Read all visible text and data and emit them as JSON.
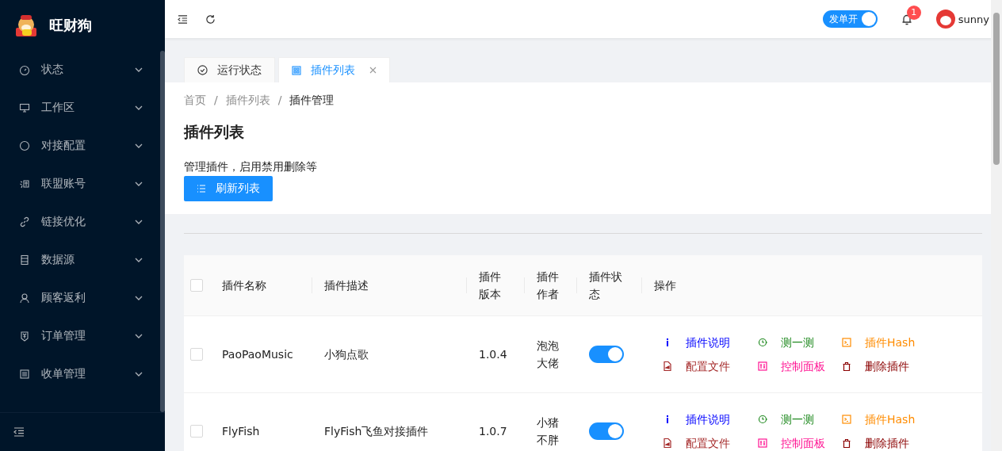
{
  "sidebar": {
    "brand": "旺财狗",
    "items": [
      {
        "label": "状态",
        "expanded": false
      },
      {
        "label": "工作区",
        "expanded": false
      },
      {
        "label": "对接配置",
        "expanded": false
      },
      {
        "label": "联盟账号",
        "expanded": false
      },
      {
        "label": "链接优化",
        "expanded": false
      },
      {
        "label": "数据源",
        "expanded": false
      },
      {
        "label": "顾客返利",
        "expanded": false
      },
      {
        "label": "订单管理",
        "expanded": false
      },
      {
        "label": "收单管理",
        "expanded": false
      }
    ]
  },
  "header": {
    "dispatch_switch": {
      "label": "发单开",
      "on": true
    },
    "notifications": "1",
    "user": "sunny"
  },
  "tabs": [
    {
      "label": "运行状态",
      "selected": false,
      "closable": false
    },
    {
      "label": "插件列表",
      "selected": true,
      "closable": true
    }
  ],
  "breadcrumb": [
    {
      "label": "首页",
      "kind": "link"
    },
    {
      "label": "/",
      "kind": "separator"
    },
    {
      "label": "插件列表",
      "kind": "link"
    },
    {
      "label": "/",
      "kind": "separator"
    },
    {
      "label": "插件管理",
      "kind": "current"
    }
  ],
  "page": {
    "title": "插件列表",
    "description": "管理插件，启用禁用删除等",
    "refresh_button": "刷新列表"
  },
  "table": {
    "all_checked": false,
    "columns": [
      "插件名称",
      "插件描述",
      "插件版本",
      "插件作者",
      "插件状态",
      "操作"
    ],
    "rows": [
      {
        "checked": false,
        "name": "PaoPaoMusic",
        "description": "小狗点歌",
        "version": "1.0.4",
        "author": "泡泡大佬",
        "on": true,
        "actions": [
          {
            "label": "插件说明",
            "kind": "info",
            "color": "#0000ff"
          },
          {
            "label": "测一测",
            "kind": "test",
            "color": "#228b22"
          },
          {
            "label": "插件Hash",
            "kind": "hash",
            "color": "#ff8c00"
          },
          {
            "label": "配置文件",
            "kind": "file",
            "color": "#a52a2a"
          },
          {
            "label": "控制面板",
            "kind": "panel",
            "color": "#ff1493"
          },
          {
            "label": "删除插件",
            "kind": "delete",
            "color": "#8b0000"
          }
        ]
      },
      {
        "checked": false,
        "name": "FlyFish",
        "description": "FlyFish飞鱼对接插件",
        "version": "1.0.7",
        "author": "小猪不胖",
        "on": true,
        "actions": [
          {
            "label": "插件说明",
            "kind": "info",
            "color": "#0000ff"
          },
          {
            "label": "测一测",
            "kind": "test",
            "color": "#228b22"
          },
          {
            "label": "插件Hash",
            "kind": "hash",
            "color": "#ff8c00"
          },
          {
            "label": "配置文件",
            "kind": "file",
            "color": "#a52a2a"
          },
          {
            "label": "控制面板",
            "kind": "panel",
            "color": "#ff1493"
          },
          {
            "label": "删除插件",
            "kind": "delete",
            "color": "#8b0000"
          }
        ]
      }
    ]
  }
}
